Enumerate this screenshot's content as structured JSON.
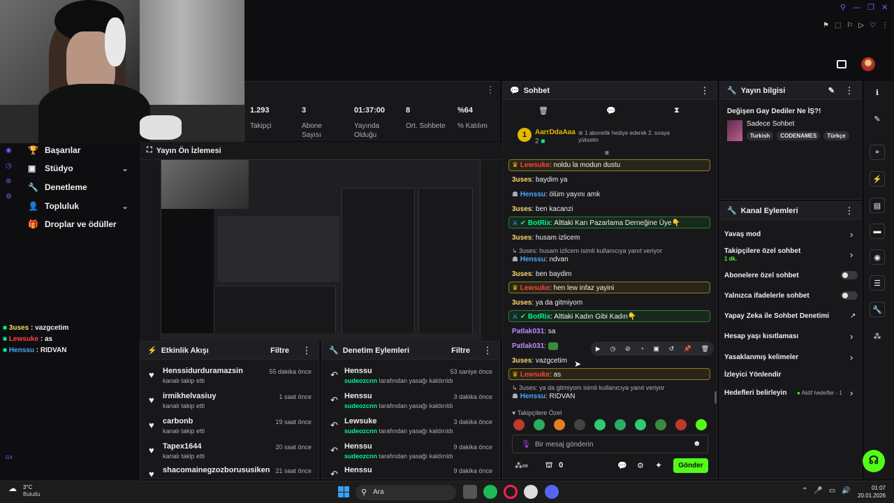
{
  "stats": [
    {
      "value": "1.293",
      "label": "Takipçi"
    },
    {
      "value": "3",
      "label": "Abone Sayısı"
    },
    {
      "value": "01:37:00",
      "label": "Yayında Olduğu"
    },
    {
      "value": "8",
      "label": "Ort. Sohbete"
    },
    {
      "value": "%64",
      "label": "% Katılım"
    }
  ],
  "nav": [
    {
      "label": "Başarılar",
      "icon": "trophy-icon"
    },
    {
      "label": "Stüdyo",
      "icon": "video-icon",
      "chevron": true
    },
    {
      "label": "Denetleme",
      "icon": "wrench-icon"
    },
    {
      "label": "Topluluk",
      "icon": "person-icon",
      "chevron": true
    },
    {
      "label": "Droplar ve ödüller",
      "icon": "gift-icon"
    }
  ],
  "overlay_chat": [
    {
      "user": "3uses",
      "text": "vazgcetim",
      "color": "#ffd86b"
    },
    {
      "user": "Lewsuke",
      "text": "as",
      "color": "#ff4040"
    },
    {
      "user": "Henssu",
      "text": "RIDVAN",
      "color": "#4aa8ff"
    }
  ],
  "preview": {
    "title": "Yayın Ön İzlemesi"
  },
  "activity": {
    "title": "Etkinlik Akışı",
    "filter": "Filtre",
    "items": [
      {
        "name": "Henssidurduramazsin",
        "sub": "kanalı takip etti",
        "time": "55 dakika önce"
      },
      {
        "name": "irmikhelvasiuy",
        "sub": "kanalı takip etti",
        "time": "1 saat önce"
      },
      {
        "name": "carbonb",
        "sub": "kanalı takip etti",
        "time": "19 saat önce"
      },
      {
        "name": "Tapex1644",
        "sub": "kanalı takip etti",
        "time": "20 saat önce"
      },
      {
        "name": "shacomainegzozborususiken",
        "sub": "",
        "time": "21 saat önce"
      }
    ]
  },
  "moderation": {
    "title": "Denetim Eylemleri",
    "filter": "Filtre",
    "items": [
      {
        "name": "Henssu",
        "mod": "sudeozcnn",
        "sub": " tarafından yasağı kaldırıldı",
        "time": "53 saniye önce"
      },
      {
        "name": "Henssu",
        "mod": "sudeozcnn",
        "sub": " tarafından yasağı kaldırıldı",
        "time": "3 dakika önce"
      },
      {
        "name": "Lewsuke",
        "mod": "sudeozcnn",
        "sub": " tarafından yasağı kaldırıldı",
        "time": "3 dakika önce"
      },
      {
        "name": "Henssu",
        "mod": "sudeozcnn",
        "sub": " tarafından yasağı kaldırıldı",
        "time": "9 dakika önce"
      },
      {
        "name": "Henssu",
        "mod": "",
        "sub": "",
        "time": "9 dakika önce"
      }
    ]
  },
  "chat": {
    "title": "Sohbet",
    "pinned_user": "AarrDdaAaa",
    "pinned_count": "2",
    "pinned_text": "1 abonelik hediye ederek 2. sıraya yükselin",
    "messages": [
      {
        "user": "Lewsuke",
        "text": "noldu la modun dustu",
        "style": "y",
        "color": "#ff4040"
      },
      {
        "user": "3uses",
        "text": "baydim ya",
        "style": "",
        "color": "#ffd86b"
      },
      {
        "user": "Henssu",
        "text": "ölüm yayını amk",
        "style": "",
        "color": "#4aa8ff"
      },
      {
        "user": "3uses",
        "text": "ben kacanzi",
        "style": "",
        "color": "#ffd86b"
      },
      {
        "user": "BotRix",
        "text": "Alttaki Karı Pazarlama Derneğine Üye👇",
        "style": "g",
        "color": "#00f593"
      },
      {
        "user": "3uses",
        "text": "husam izlicem",
        "style": "",
        "color": "#ffd86b"
      },
      {
        "reply": "3uses: husam izlicem isimli kullanıcıya yanıt veriyor",
        "user": "Henssu",
        "text": "ndvan",
        "style": "",
        "color": "#4aa8ff"
      },
      {
        "user": "3uses",
        "text": "ben baydim",
        "style": "",
        "color": "#ffd86b"
      },
      {
        "user": "Lewsuke",
        "text": "hen lew infaz yayini",
        "style": "y",
        "color": "#ff4040"
      },
      {
        "user": "3uses",
        "text": "ya da gitmiyom",
        "style": "",
        "color": "#ffd86b"
      },
      {
        "user": "BotRix",
        "text": "Alttaki Kadın Gibi Kadın👇",
        "style": "g",
        "color": "#00f593"
      },
      {
        "user": "Patlak031",
        "text": "sa",
        "style": "",
        "color": "#b68cff"
      },
      {
        "user": "Patlak031",
        "text": "",
        "style": "",
        "color": "#b68cff"
      },
      {
        "user": "3uses",
        "text": "vazgcetim",
        "style": "",
        "color": "#ffd86b"
      },
      {
        "user": "Lewsuke",
        "text": "as",
        "style": "y",
        "color": "#ff4040"
      },
      {
        "reply": "3uses: ya da gitmiyom isimli kullanıcıya yanıt veriyor",
        "user": "Henssu",
        "text": "RIDVAN",
        "style": "",
        "color": "#4aa8ff"
      }
    ],
    "emote_header": "Takipçilere Özel",
    "input_placeholder": "Bir mesaj gönderin",
    "points": "0",
    "send": "Gönder"
  },
  "stream_info": {
    "title": "Yayın bilgisi",
    "stream_title": "Değişen Gay Dediler Ne İŞ?!",
    "category": "Sadece Sohbet",
    "tags": [
      "Turkish",
      "CODENAMES",
      "Türkçe"
    ]
  },
  "channel_actions": {
    "title": "Kanal Eylemleri",
    "rows": [
      {
        "label": "Yavaş mod",
        "type": "chevron"
      },
      {
        "label": "Takipçilere özel sohbet",
        "type": "chevron",
        "sub": "1 dk."
      },
      {
        "label": "Abonelere özel sohbet",
        "type": "toggle"
      },
      {
        "label": "Yalnızca ifadelerle sohbet",
        "type": "toggle"
      },
      {
        "label": "Yapay Zeka ile Sohbet Denetimi",
        "type": "external"
      },
      {
        "label": "Hesap yaşı kısıtlaması",
        "type": "chevron"
      },
      {
        "label": "Yasaklanmış kelimeler",
        "type": "chevron"
      },
      {
        "label": "İzleyici Yönlendir",
        "type": "none"
      },
      {
        "label": "Hedefleri belirleyin",
        "type": "goal",
        "extra": "Aktif hedefler - 1"
      }
    ]
  },
  "taskbar": {
    "weather_temp": "3°C",
    "weather_desc": "Bulutlu",
    "search": "Ara",
    "time": "01:07",
    "date": "20.01.2026"
  },
  "misc": {
    "gx": "GX"
  }
}
